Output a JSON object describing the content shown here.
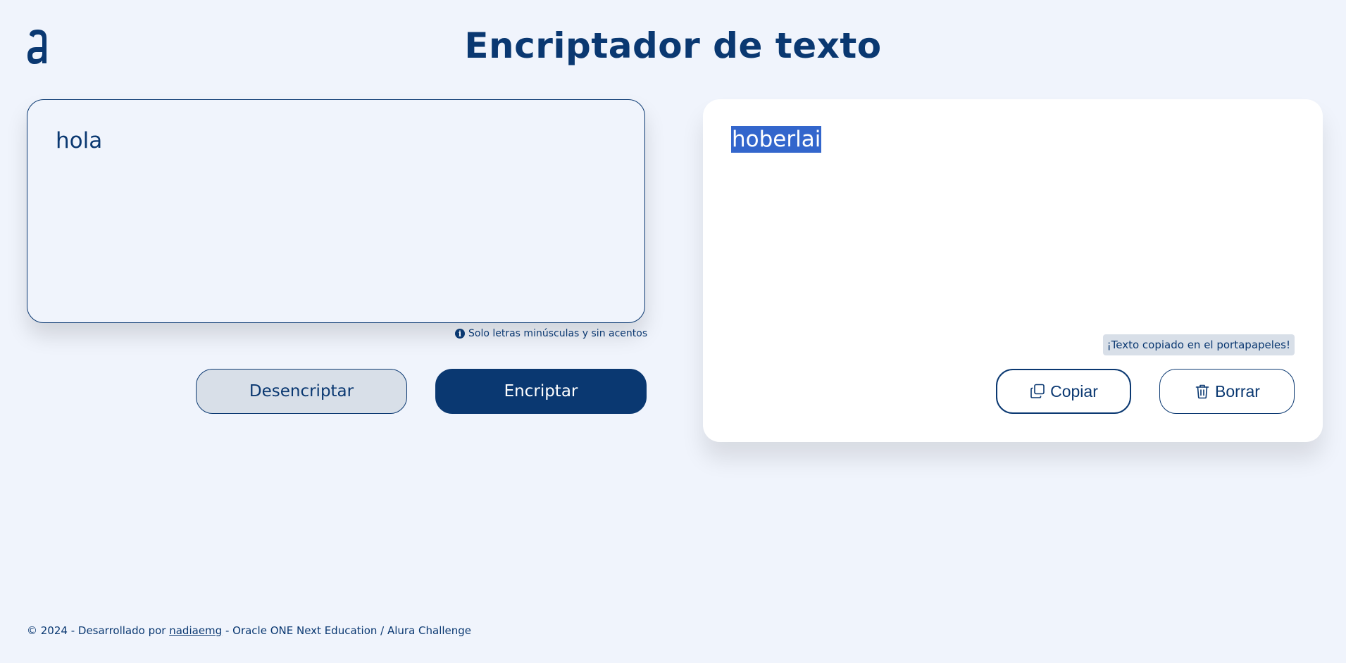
{
  "header": {
    "logo_letter": "a",
    "title": "Encriptador de texto"
  },
  "input": {
    "value": "hola",
    "hint": "Solo letras minúsculas y sin acentos",
    "hint_icon": "info-icon"
  },
  "actions": {
    "decrypt_label": "Desencriptar",
    "encrypt_label": "Encriptar"
  },
  "output": {
    "text": "hoberlai",
    "toast": "¡Texto copiado en el portapapeles!",
    "copy_label": "Copiar",
    "copy_icon": "copy-icon",
    "clear_label": "Borrar",
    "clear_icon": "trash-icon"
  },
  "footer": {
    "prefix": "© 2024 - Desarrollado por ",
    "author_link": "nadiaemg",
    "suffix": " - Oracle ONE Next Education / Alura Challenge"
  },
  "colors": {
    "primary": "#0a3871",
    "background": "#f0f4fc",
    "secondary_button": "#d8dfe8",
    "selection": "#3366cc"
  }
}
